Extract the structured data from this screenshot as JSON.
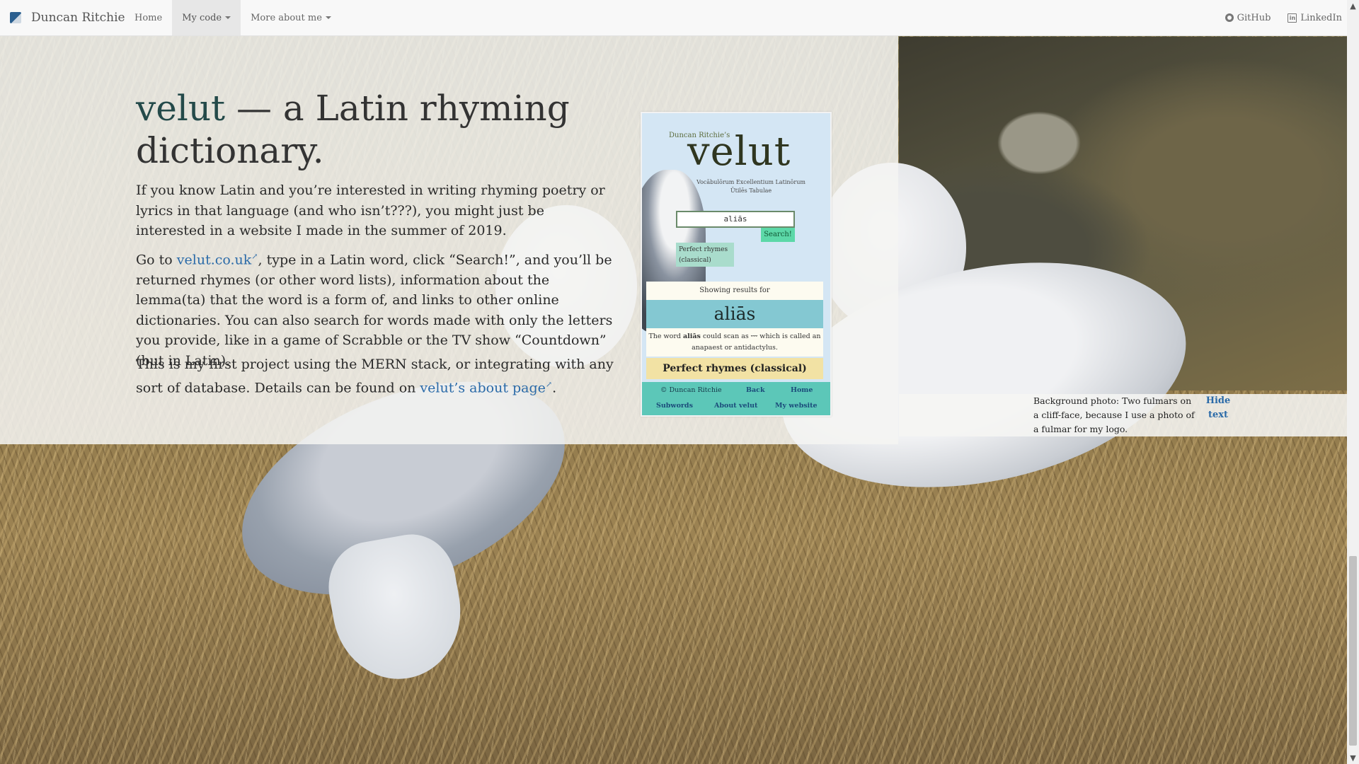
{
  "navbar": {
    "brand": "Duncan Ritchie",
    "home": "Home",
    "my_code": "My code",
    "more_about_me": "More about me",
    "github": "GitHub",
    "linkedin": "LinkedIn"
  },
  "main": {
    "title_accent": "velut",
    "title_rest": " — a Latin rhyming dictionary.",
    "p1": "If you know Latin and you’re interested in writing rhyming poetry or lyrics in that language (and who isn’t???), you might just be interested in a website I made in the summer of 2019.",
    "p2_before": "Go to ",
    "p2_link": "velut.co.uk",
    "p2_after": ", type in a Latin word, click “Search!”, and you’ll be returned rhymes (or other word lists), information about the lemma(ta) that the word is a form of, and links to other online dictionaries. You can also search for words made with only the letters you provide, like in a game of Scrabble or the TV show “Countdown” (but in Latin).",
    "p3_before": "This is my first project using the MERN stack, or integrating with any sort of database. Details can be found on ",
    "p3_link": "velut’s about page",
    "p3_after": ".",
    "ext_glyph": "↗"
  },
  "mock": {
    "byline": "Duncan Ritchie’s",
    "logo": "velut",
    "subtitle": "Vocābulōrum Excellentium Latinōrum Ūtilēs Tabulae",
    "input_value": "aliās",
    "search_button": "Search!",
    "mode": "Perfect rhymes (classical)",
    "showing": "Showing results for",
    "word": "aliās",
    "scan_before": "The word ",
    "scan_word": "aliās",
    "scan_after": " could scan as ⏑⏑⏑ which is called an anapaest or antidactylus.",
    "perfect_heading": "Perfect rhymes (classical)",
    "footer": {
      "copyright": "© Duncan Ritchie",
      "back": "Back",
      "home": "Home",
      "subwords": "Subwords",
      "about": "About velut",
      "website": "My website"
    }
  },
  "caption": {
    "text": "Background photo: Two fulmars on a cliff-face, because I use a photo of a fulmar for my logo.",
    "hide": "Hide text"
  },
  "scrollbar": {
    "up": "▲",
    "down": "▼"
  },
  "colors": {
    "link": "#2a6aa8",
    "accent": "#244a4a",
    "mock_button": "#5cd8a8",
    "mock_word_bg": "#84c8d2",
    "mock_footer": "#5cc7b8"
  }
}
